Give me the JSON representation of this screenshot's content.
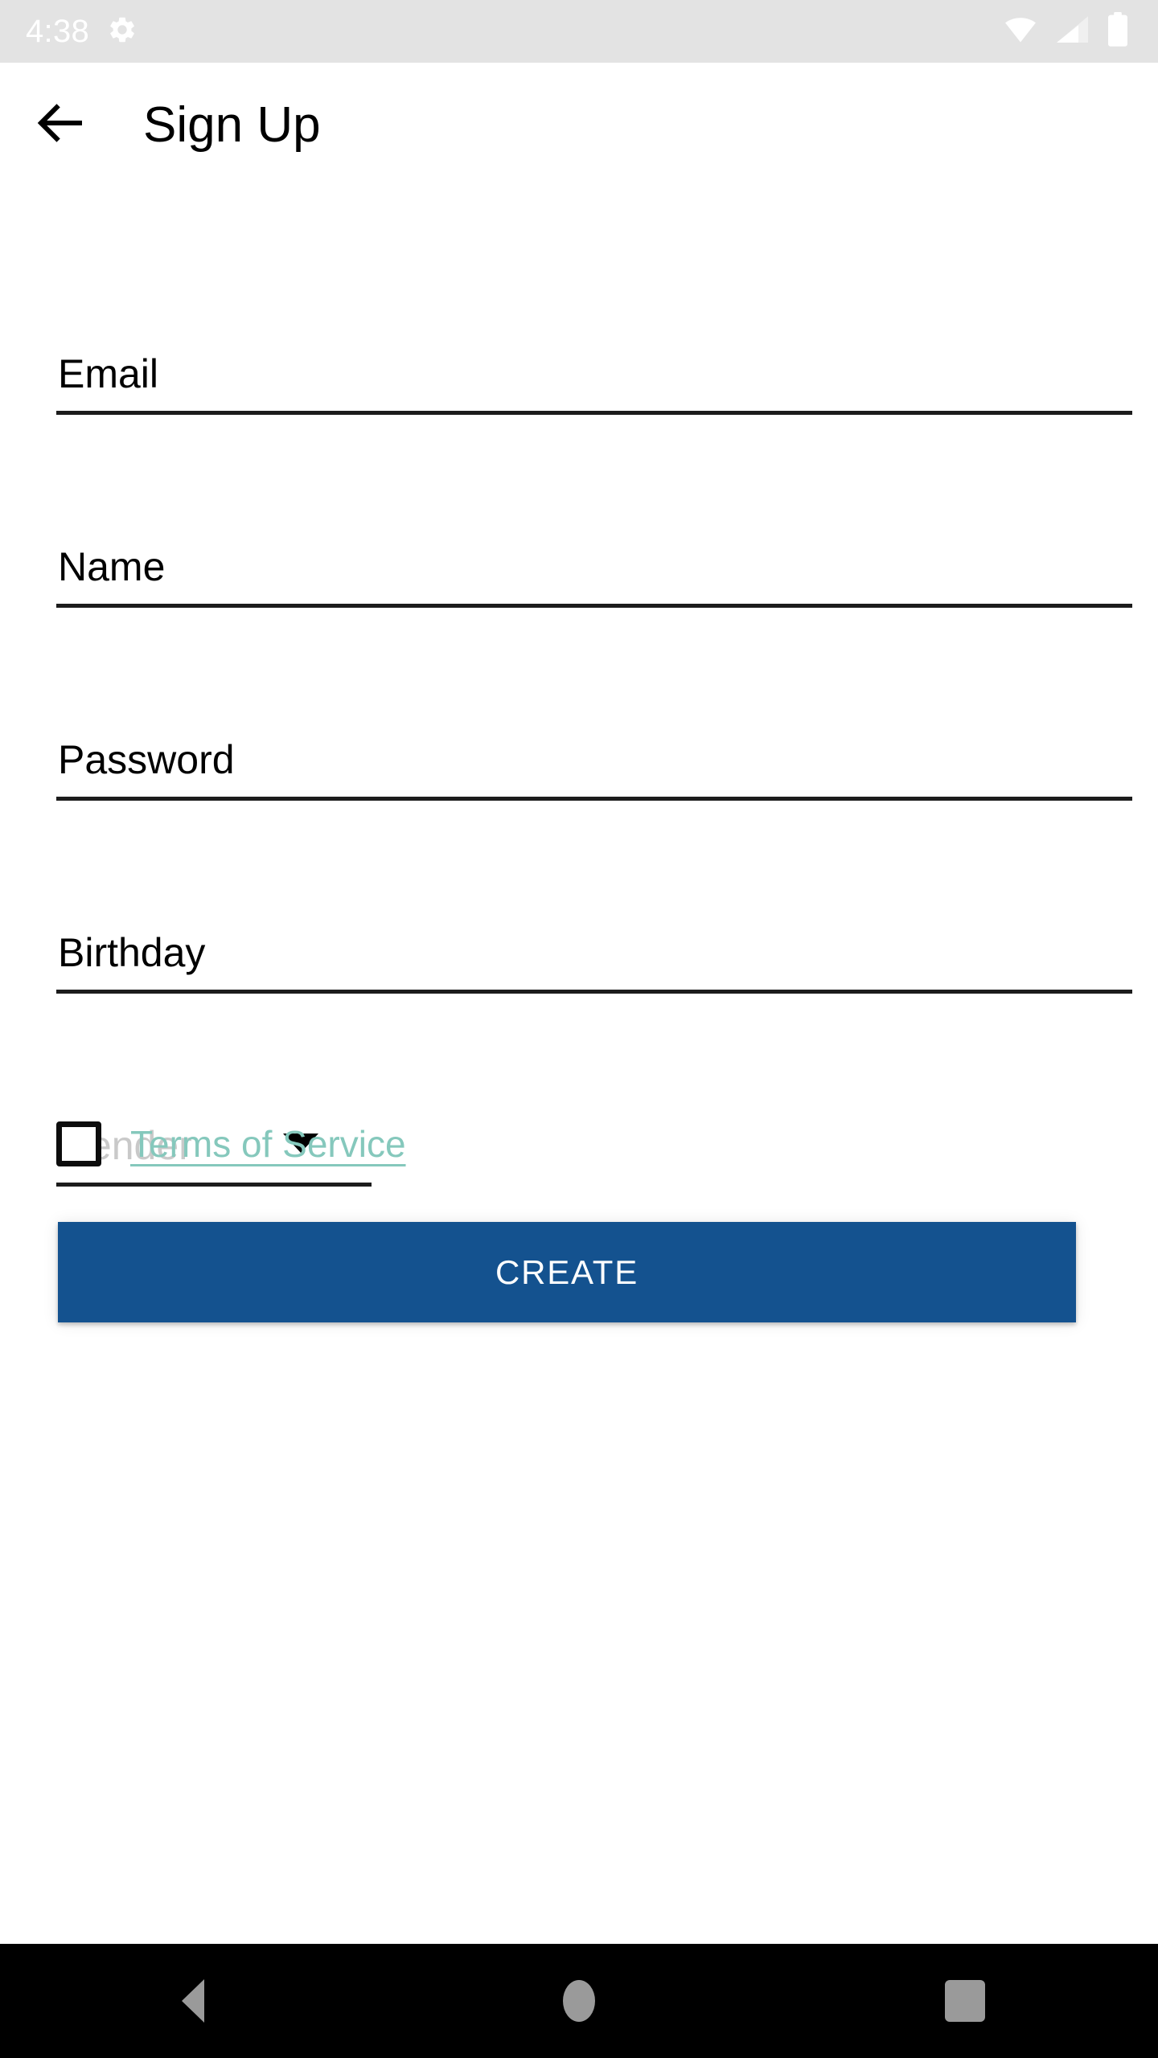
{
  "status_bar": {
    "clock": "4:38",
    "icons": {
      "settings": "gear-icon",
      "wifi": "wifi-icon",
      "signal": "signal-icon",
      "battery": "battery-icon"
    },
    "background_color": "#E3E3E3",
    "foreground_color": "#FFFFFF"
  },
  "app_bar": {
    "back_icon": "arrow-left-icon",
    "title": "Sign Up"
  },
  "form": {
    "fields": [
      {
        "label": "Email",
        "value": "",
        "type": "text"
      },
      {
        "label": "Name",
        "value": "",
        "type": "text"
      },
      {
        "label": "Password",
        "value": "",
        "type": "password"
      },
      {
        "label": "Birthday",
        "value": "",
        "type": "date"
      }
    ],
    "spinner": {
      "label": "Gender",
      "selected": "",
      "placeholder": "Gender",
      "arrow_icon": "chevron-down-icon",
      "placeholder_color": "#C9C9C9"
    },
    "terms": {
      "checked": false,
      "link_text": "Terms of Service",
      "link_color": "#85C8BC"
    },
    "submit": {
      "label": "CREATE",
      "background_color": "#14528F",
      "text_color": "#FFFFFF"
    }
  },
  "navigation_bar": {
    "background_color": "#000000",
    "icon_color": "#9A9A9A",
    "buttons": [
      {
        "name": "back",
        "icon": "triangle-left-icon"
      },
      {
        "name": "home",
        "icon": "circle-icon"
      },
      {
        "name": "recents",
        "icon": "square-icon"
      }
    ]
  }
}
